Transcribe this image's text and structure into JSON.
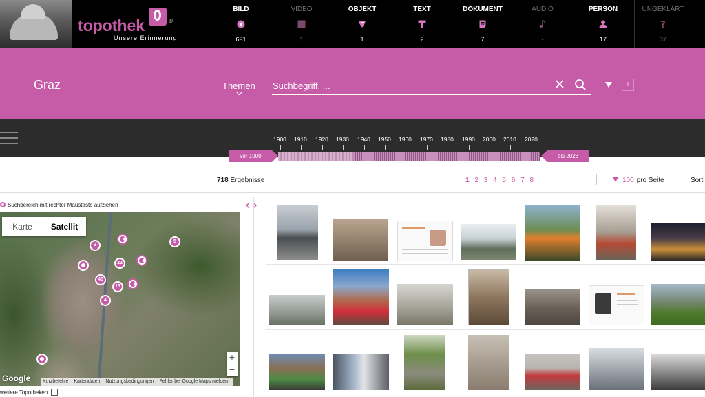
{
  "brand": {
    "name": "topothek",
    "reg": "®",
    "tagline": "Unsere Erinnerung"
  },
  "media_types": [
    {
      "label": "BILD",
      "count": "691",
      "icon": "image-icon",
      "active": true
    },
    {
      "label": "VIDEO",
      "count": "1",
      "icon": "video-icon",
      "active": false
    },
    {
      "label": "OBJEKT",
      "count": "1",
      "icon": "object-icon",
      "active": true
    },
    {
      "label": "TEXT",
      "count": "2",
      "icon": "text-icon",
      "active": true
    },
    {
      "label": "DOKUMENT",
      "count": "7",
      "icon": "document-icon",
      "active": true
    },
    {
      "label": "AUDIO",
      "count": "-",
      "icon": "audio-icon",
      "active": false
    },
    {
      "label": "PERSON",
      "count": "17",
      "icon": "person-icon",
      "active": true
    },
    {
      "label": "UNGEKLÄRT",
      "count": "37",
      "icon": "question-icon",
      "active": false
    }
  ],
  "search": {
    "place": "Graz",
    "themen_label": "Themen",
    "placeholder": "Suchbegriff, ...",
    "info_label": "i"
  },
  "timeline": {
    "years": [
      "1900",
      "1910",
      "1920",
      "1930",
      "1940",
      "1950",
      "1960",
      "1970",
      "1980",
      "1990",
      "2000",
      "2010",
      "2020"
    ],
    "from_label": "vor 1900",
    "to_label": "bis 2023"
  },
  "results": {
    "count": "718",
    "count_label": "Ergebnisse",
    "pages": [
      "1",
      "2",
      "3",
      "4",
      "5",
      "6",
      "7",
      "8"
    ],
    "current_page": "1",
    "per_page_value": "100",
    "per_page_label": "pro Seite",
    "sort_label": "Sorti"
  },
  "map": {
    "hint": "Suchbereich mit rechter Maustaste aufziehen",
    "type_karte": "Karte",
    "type_satellit": "Satellit",
    "google_label": "Google",
    "footer_links": [
      "Kurzbefehle",
      "Kartendaten",
      "Nutzungsbedingungen",
      "Fehler bei Google Maps melden"
    ],
    "zoom_in": "+",
    "zoom_out": "−",
    "markers": [
      "3",
      "5",
      "22",
      "40",
      "13",
      "4"
    ],
    "weitere_label": "weitere Topotheken"
  },
  "colors": {
    "accent": "#c65ba8",
    "topbar": "#000000",
    "timeband": "#2c2c2c"
  }
}
